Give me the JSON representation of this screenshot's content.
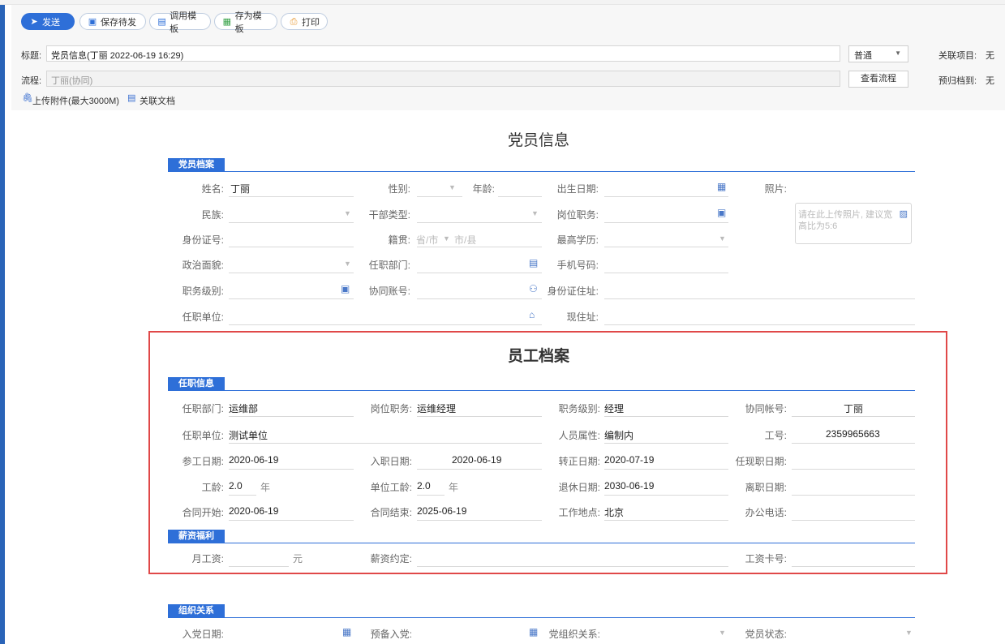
{
  "toolbar": {
    "send": "发送",
    "save_draft": "保存待发",
    "use_template": "调用模板",
    "save_template": "存为模板",
    "print": "打印"
  },
  "header": {
    "title_label": "标题:",
    "title_value": "党员信息(丁丽 2022-06-19 16:29)",
    "flow_label": "流程:",
    "flow_value": "丁丽(协同)",
    "priority_value": "普通",
    "view_flow": "查看流程",
    "related_project_label": "关联项目:",
    "related_project_value": "无",
    "archive_label": "预归档到:",
    "archive_value": "无",
    "upload": "上传附件(最大3000M)",
    "related_doc": "关联文档"
  },
  "form": {
    "doc_title": "党员信息",
    "sec1": "党员档案",
    "name_label": "姓名:",
    "name_value": "丁丽",
    "gender_label": "性别:",
    "age_label": "年龄:",
    "birth_label": "出生日期:",
    "photo_label": "照片:",
    "ethnic_label": "民族:",
    "cadre_label": "干部类型:",
    "post_label": "岗位职务:",
    "photo_hint": "请在此上传照片, 建议宽高比为5:6",
    "id_label": "身份证号:",
    "native_label": "籍贯:",
    "province_ph": "省/市",
    "city_ph": "市/县",
    "edu_label": "最高学历:",
    "political_label": "政治面貌:",
    "dept_label": "任职部门:",
    "mobile_label": "手机号码:",
    "rank_label": "职务级别:",
    "account_label": "协同账号:",
    "id_addr_label": "身份证住址:",
    "unit_label": "任职单位:",
    "addr_label": "现住址:",
    "emp_title": "员工档案",
    "sec2": "任职信息",
    "e_dept_label": "任职部门:",
    "e_dept_value": "运维部",
    "e_post_label": "岗位职务:",
    "e_post_value": "运维经理",
    "e_rank_label": "职务级别:",
    "e_rank_value": "经理",
    "e_account_label": "协同帐号:",
    "e_account_value": "丁丽",
    "e_unit_label": "任职单位:",
    "e_unit_value": "测试单位",
    "e_attr_label": "人员属性:",
    "e_attr_value": "编制内",
    "e_no_label": "工号:",
    "e_no_value": "2359965663",
    "e_join_label": "参工日期:",
    "e_join_value": "2020-06-19",
    "e_entry_label": "入职日期:",
    "e_entry_value": "2020-06-19",
    "e_regular_label": "转正日期:",
    "e_regular_value": "2020-07-19",
    "e_curpost_label": "任现职日期:",
    "e_seniority_label": "工龄:",
    "e_seniority_value": "2.0",
    "year_unit": "年",
    "e_unit_sen_label": "单位工龄:",
    "e_unit_sen_value": "2.0",
    "year_unit2": "年",
    "e_retire_label": "退休日期:",
    "e_retire_value": "2030-06-19",
    "e_leave_label": "离职日期:",
    "e_cstart_label": "合同开始:",
    "e_cstart_value": "2020-06-19",
    "e_cend_label": "合同结束:",
    "e_cend_value": "2025-06-19",
    "e_place_label": "工作地点:",
    "e_place_value": "北京",
    "e_phone_label": "办公电话:",
    "sec3": "薪资福利",
    "salary_label": "月工资:",
    "salary_unit": "元",
    "salary_agree_label": "薪资约定:",
    "card_label": "工资卡号:",
    "sec4": "组织关系",
    "join_party_label": "入党日期:",
    "prep_label": "预备入党:",
    "org_label": "党组织关系:",
    "party_status_label": "党员状态:"
  }
}
